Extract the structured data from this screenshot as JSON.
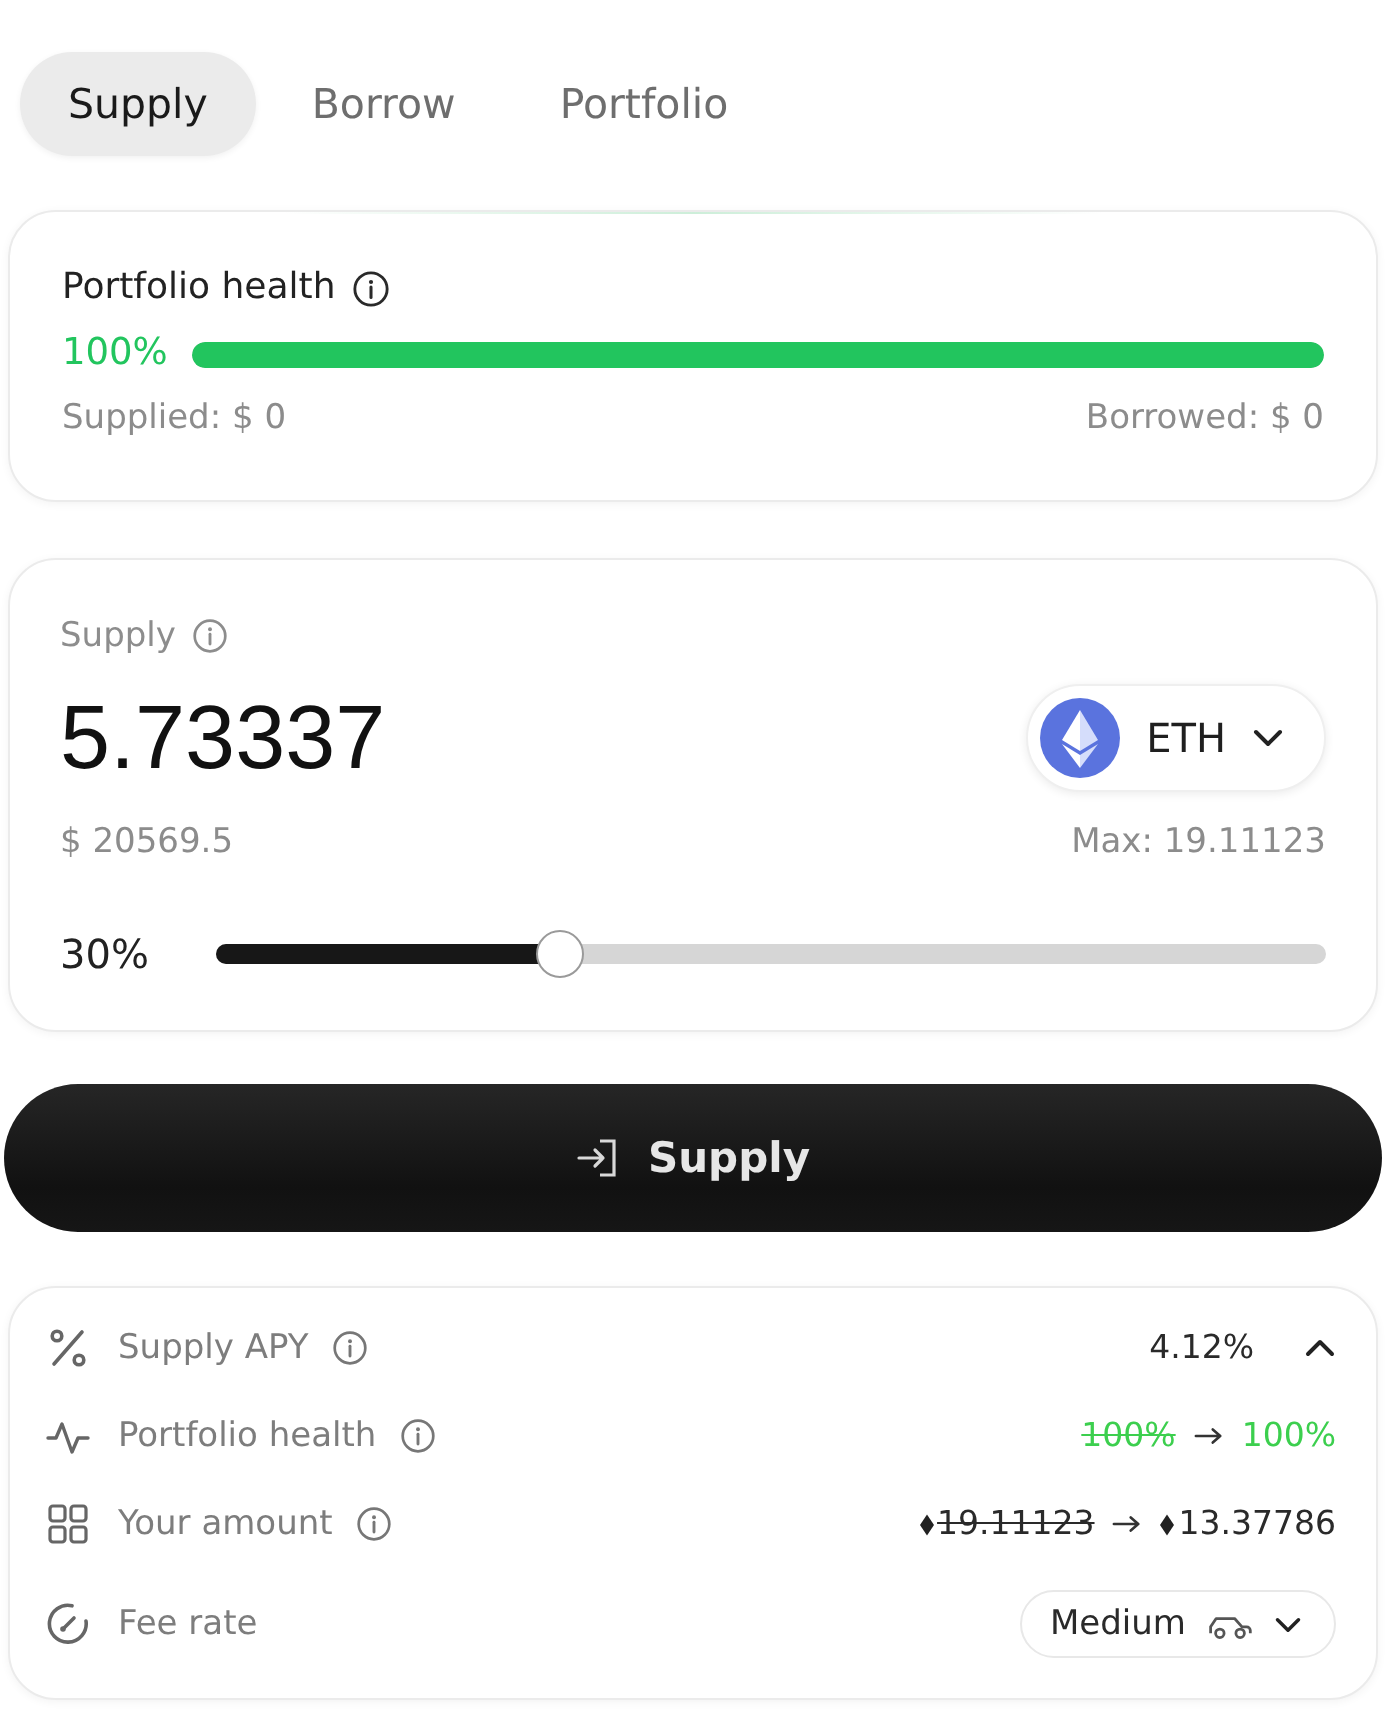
{
  "tabs": [
    {
      "label": "Supply",
      "selected": true
    },
    {
      "label": "Borrow",
      "selected": false
    },
    {
      "label": "Portfolio",
      "selected": false
    }
  ],
  "health_card": {
    "title": "Portfolio health",
    "info": true,
    "percent": "100%",
    "level": 1.0,
    "supplied": "Supplied: $ 0",
    "borrowed": "Borrowed: $ 0"
  },
  "supply_card": {
    "label": "Supply",
    "info": true,
    "amount": "5.73337",
    "token": "ETH",
    "usd_value": "$ 20569.5",
    "max": "Max: 19.11123",
    "percent": "30%",
    "level": 0.31
  },
  "action_button": {
    "label": "Supply"
  },
  "details": {
    "rows": [
      {
        "kind": "toggle",
        "label": "Supply APY",
        "info": true,
        "value": "4.12%",
        "expanded": true
      },
      {
        "kind": "change",
        "label": "Portfolio health",
        "info": true,
        "old": "100%",
        "new": "100%"
      },
      {
        "kind": "token_change",
        "label": "Your amount",
        "info": true,
        "old": "19.11123",
        "new": "13.37786"
      },
      {
        "kind": "select",
        "label": "Fee rate",
        "info": false,
        "value": "Medium"
      }
    ]
  }
}
